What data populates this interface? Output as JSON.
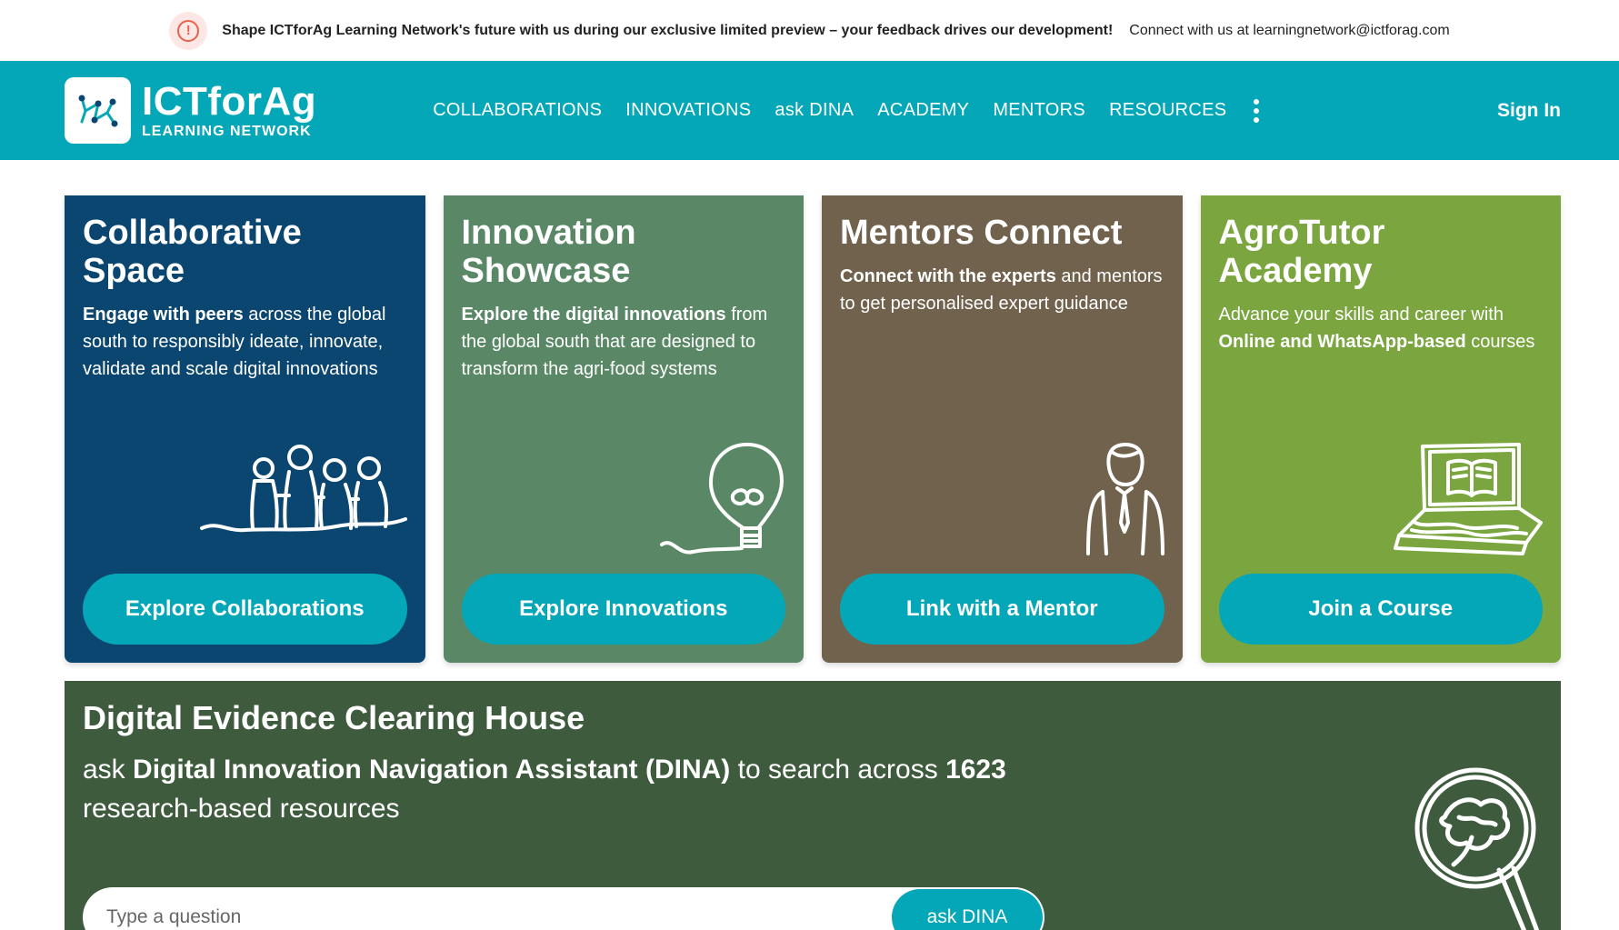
{
  "banner": {
    "message": "Shape ICTforAg Learning Network's future with us during our exclusive limited preview – your feedback drives our development!",
    "contact": "Connect with us at learningnetwork@ictforag.com",
    "alert_icon": "alert-circle-icon",
    "accent": "#e8614a"
  },
  "nav": {
    "brand": "ICTforAg",
    "brand_sub": "LEARNING NETWORK",
    "items": [
      {
        "label": "COLLABORATIONS"
      },
      {
        "label": "INNOVATIONS"
      },
      {
        "label": "ask DINA"
      },
      {
        "label": "ACADEMY"
      },
      {
        "label": "MENTORS"
      },
      {
        "label": "RESOURCES"
      }
    ],
    "more_icon": "kebab-menu-icon",
    "sign_in": "Sign In",
    "bg": "#04a7b7"
  },
  "cards": [
    {
      "title": "Collaborative Space",
      "desc_bold": "Engage with peers",
      "desc_rest": " across the global south to responsibly ideate, innovate, validate and scale digital innovations",
      "button": "Explore Collaborations",
      "icon": "group-of-people-icon",
      "color": "#0b4670"
    },
    {
      "title": "Innovation Showcase",
      "desc_bold": "Explore the digital innovations",
      "desc_rest": " from the global south that are designed to transform the agri-food systems",
      "button": "Explore Innovations",
      "icon": "lightbulb-icon",
      "color": "#5a8866"
    },
    {
      "title": "Mentors Connect",
      "desc_bold": "Connect with the experts",
      "desc_rest": " and mentors to get personalised expert guidance",
      "button": "Link with a Mentor",
      "icon": "mentor-person-icon",
      "color": "#71624d"
    },
    {
      "title": "AgroTutor Academy",
      "desc_pre": "Advance your skills and career with ",
      "desc_bold": "Online and WhatsApp-based",
      "desc_rest": " courses",
      "button": "Join a Course",
      "icon": "laptop-book-icon",
      "color": "#7aa53f"
    }
  ],
  "dech": {
    "title": "Digital Evidence Clearing House",
    "lead_pre": "ask ",
    "lead_bold": "Digital Innovation Navigation Assistant (DINA)",
    "lead_mid": " to search across ",
    "lead_count": "1623",
    "lead_post": " research-based resources",
    "search_placeholder": "Type a question",
    "search_button": "ask DINA",
    "icon": "magnifying-glass-icon",
    "color": "#3e5b3d"
  }
}
